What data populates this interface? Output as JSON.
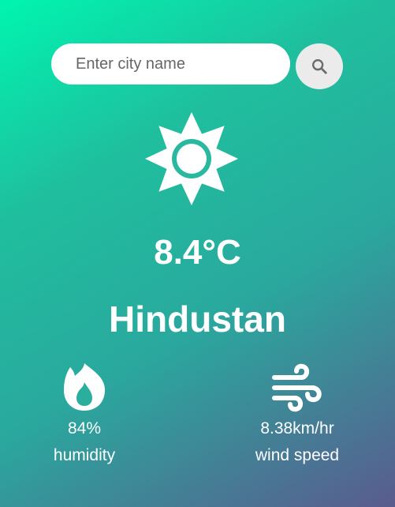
{
  "search": {
    "placeholder": "Enter city name",
    "button_icon": "search-icon"
  },
  "weather": {
    "icon": "sun-icon",
    "temperature": "8.4°C",
    "city": "Hindustan"
  },
  "stats": {
    "humidity": {
      "icon": "humidity-icon",
      "value": "84%",
      "label": "humidity"
    },
    "wind": {
      "icon": "wind-icon",
      "value": "8.38km/hr",
      "label": "wind speed"
    }
  },
  "colors": {
    "gradient_start": "#00f5b0",
    "gradient_mid": "#2aa89e",
    "gradient_end": "#5a5b8e",
    "text": "#ffffff",
    "search_button_bg": "#ebebeb",
    "icon_accent": "#1fbf9e"
  }
}
